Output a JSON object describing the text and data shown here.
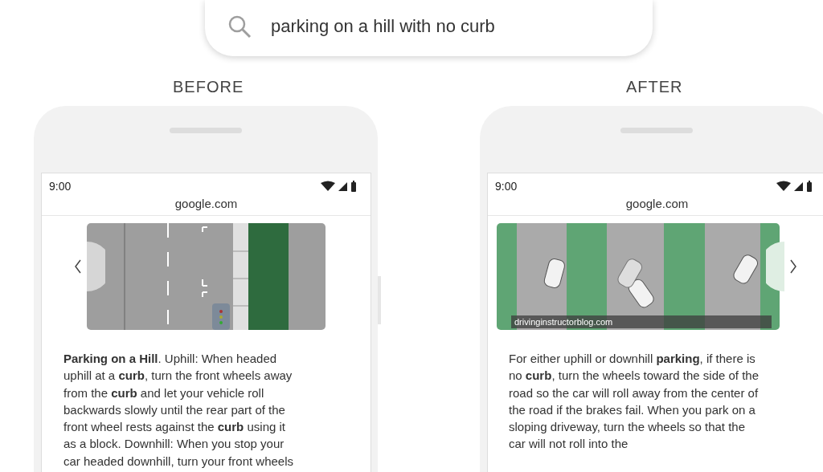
{
  "search": {
    "query": "parking on a hill with no curb"
  },
  "panels": [
    {
      "heading": "BEFORE",
      "phone": {
        "time": "9:00",
        "url": "google.com",
        "image": {
          "kind": "road",
          "prev_button": true,
          "next_button": false
        },
        "snippet": "**Parking on a Hill**. Uphill: When headed uphill at a **curb**, turn the front wheels away from the **curb** and let your vehicle roll backwards slowly until the rear part of the front wheel rests against the **curb** using it as a block. Downhill: When you stop your car headed downhill, turn your front wheels"
      }
    },
    {
      "heading": "AFTER",
      "phone": {
        "time": "9:00",
        "url": "google.com",
        "image": {
          "kind": "diagram",
          "prev_button": false,
          "next_button": true,
          "caption": "drivinginstructorblog.com"
        },
        "snippet": "For either uphill or downhill **parking**, if there is no **curb**, turn the wheels toward the side of the road so the car will roll away from the center of the road if the brakes fail. When you park on a sloping driveway, turn the wheels so that the car will not roll into the"
      }
    }
  ]
}
